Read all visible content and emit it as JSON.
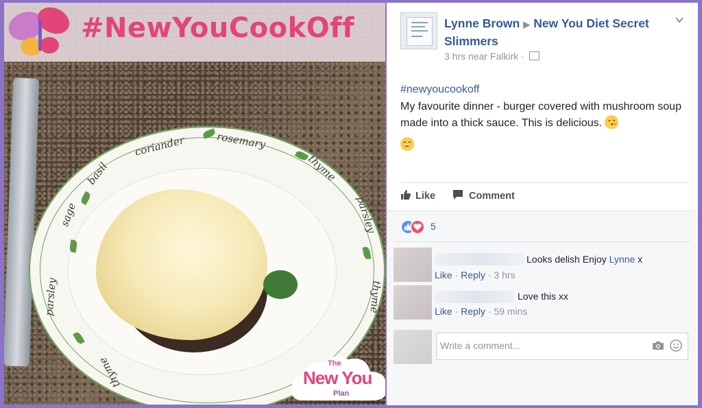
{
  "banner": {
    "hashtag": "#NewYouCookOff",
    "pink": "#e2457a"
  },
  "plate": {
    "herbs": [
      "coriander",
      "rosemary",
      "thyme",
      "parsley",
      "thyme",
      "basil",
      "sage",
      "parsley",
      "thyme"
    ]
  },
  "logo": {
    "top": "The",
    "main": "New You",
    "reg": "®",
    "bottom": "Plan"
  },
  "post": {
    "author": "Lynne Brown",
    "group": "New You Diet Secret Slimmers",
    "meta": "3 hrs near Falkirk",
    "hashtag": "#newyoucookoff",
    "text": "My favourite dinner - burger covered with mushroom soup made into a thick sauce. This is delicious.",
    "like_label": "Like",
    "comment_label": "Comment",
    "reaction_count": "5"
  },
  "comments": [
    {
      "text": "Looks delish Enjoy",
      "mention": "Lynne",
      "suffix": "x",
      "like": "Like",
      "reply": "Reply",
      "time": "3 hrs"
    },
    {
      "text": "Love this xx",
      "like": "Like",
      "reply": "Reply",
      "time": "59 mins"
    }
  ],
  "composer": {
    "placeholder": "Write a comment..."
  },
  "colors": {
    "fb_link": "#365899",
    "frame": "#8a73c9",
    "text": "#1d2129",
    "muted": "#90949c"
  }
}
